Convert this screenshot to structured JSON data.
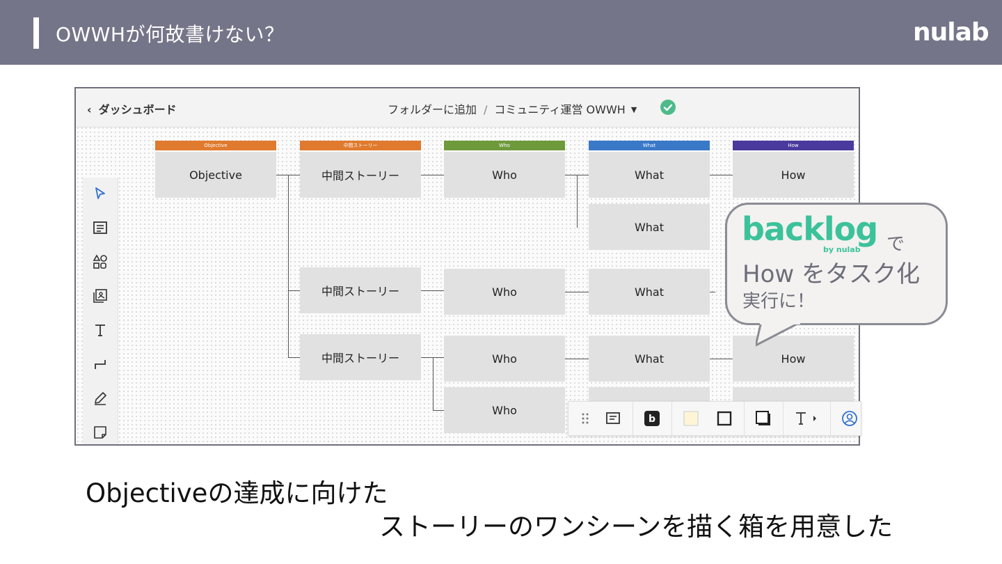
{
  "slide": {
    "title": "OWWHが何故書けない？",
    "logo_text": "nulab",
    "caption_line1": "Objectiveの達成に向けた",
    "caption_line2": "ストーリーのワンシーンを描く箱を用意した"
  },
  "app": {
    "back_label": "ダッシュボード",
    "breadcrumb_folder": "フォルダーに追加",
    "breadcrumb_sep": "/",
    "breadcrumb_doc": "コミュニティ運営 OWWH",
    "status_icon": "check-circle-icon",
    "tools": [
      "cursor-icon",
      "card-icon",
      "shapes-icon",
      "image-icon",
      "text-icon",
      "connector-icon",
      "pen-icon",
      "sticky-note-icon"
    ]
  },
  "lanes": [
    {
      "label": "Objective",
      "color": "#e07a2e"
    },
    {
      "label": "中間ストーリー",
      "color": "#e07a2e"
    },
    {
      "label": "Who",
      "color": "#6f9a3c"
    },
    {
      "label": "What",
      "color": "#3a78c8"
    },
    {
      "label": "How",
      "color": "#4b3a9e"
    }
  ],
  "cards": {
    "objective": "Objective",
    "story1": "中間ストーリー",
    "story2": "中間ストーリー",
    "story3": "中間ストーリー",
    "who1": "Who",
    "who2": "Who",
    "who3": "Who",
    "who4": "Who",
    "what1": "What",
    "what2": "What",
    "what3": "What",
    "what4": "What",
    "how1": "How",
    "how2": "How"
  },
  "bubble": {
    "logo": "backlog",
    "logo_sub": "by nulab",
    "text_de": "で",
    "text_line2": "How をタスク化",
    "text_line3": "実行に！"
  },
  "float_toolbar": {
    "items": [
      "drag-handle-icon",
      "card-style-icon",
      "backlog-icon",
      "fill-color-icon",
      "border-icon",
      "shadow-icon",
      "text-format-icon",
      "user-icon"
    ],
    "fill_color": "#fdf5d6"
  }
}
